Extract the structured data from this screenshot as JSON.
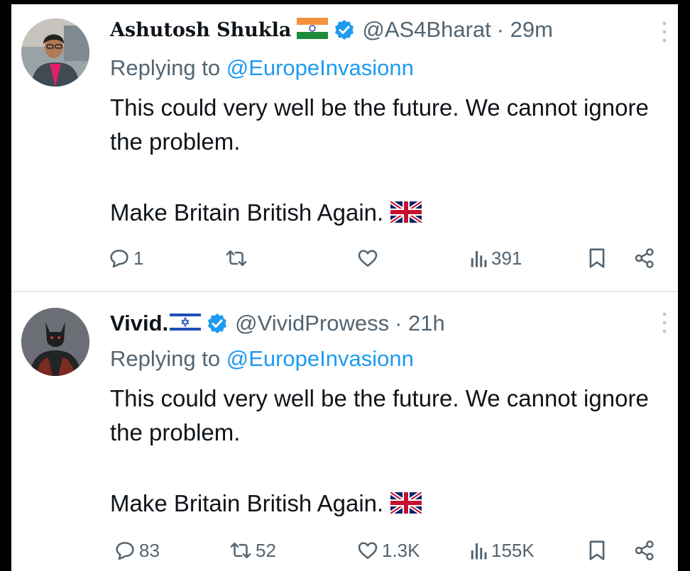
{
  "tweets": [
    {
      "name": "Ashutosh Shukla",
      "flag_icon": "india-flag-icon",
      "handle": "@AS4Bharat",
      "time": "· 29m",
      "replying_prefix": "Replying to",
      "replying_to": "@EuropeInvasionn",
      "body_line1": "This could very well be the future. We cannot ignore the problem.",
      "body_line2": "Make Britain British Again.",
      "counts": {
        "replies": "1",
        "retweets": "",
        "likes": "",
        "views": "391"
      }
    },
    {
      "name": "Vivid.",
      "flag_icon": "israel-flag-icon",
      "handle": "@VividProwess",
      "time": "· 21h",
      "replying_prefix": "Replying to",
      "replying_to": "@EuropeInvasionn",
      "body_line1": "This could very well be the future. We cannot ignore the problem.",
      "body_line2": "Make Britain British Again.",
      "counts": {
        "replies": "83",
        "retweets": "52",
        "likes": "1.3K",
        "views": "155K"
      }
    }
  ],
  "colors": {
    "accent": "#1d9bf0",
    "text": "#0f1419",
    "secondary": "#536471",
    "background": "#ffffff",
    "outer_border": "#000000"
  }
}
